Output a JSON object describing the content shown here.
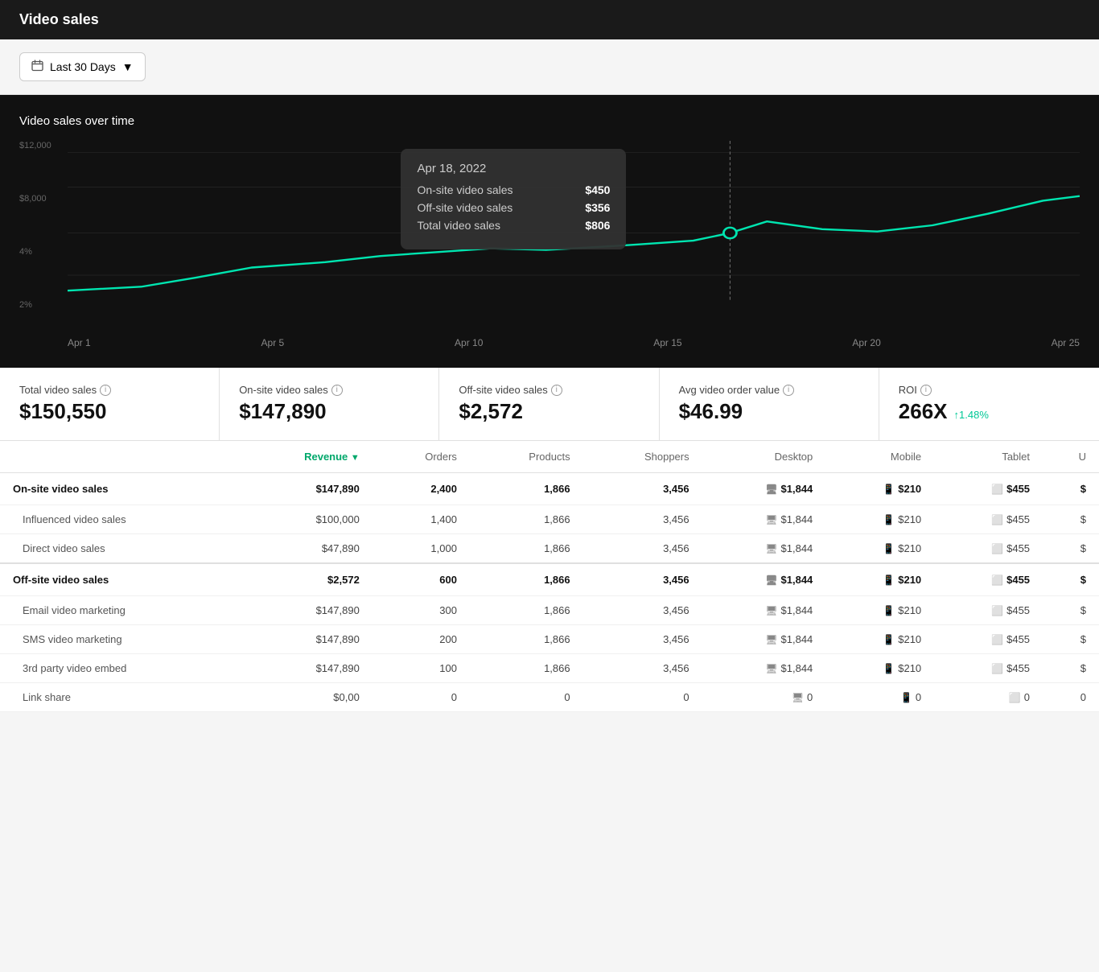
{
  "header": {
    "title": "Video sales"
  },
  "toolbar": {
    "date_filter_label": "Last 30 Days",
    "calendar_icon": "📅"
  },
  "chart": {
    "title": "Video sales over time",
    "y_labels": [
      "$12,000",
      "$8,000",
      "4%",
      "2%"
    ],
    "x_labels": [
      "Apr 1",
      "Apr 5",
      "Apr 10",
      "Apr 15",
      "Apr 20",
      "Apr 25"
    ],
    "tooltip": {
      "date": "Apr 18, 2022",
      "rows": [
        {
          "label": "On-site video sales",
          "value": "$450"
        },
        {
          "label": "Off-site video sales",
          "value": "$356"
        },
        {
          "label": "Total video sales",
          "value": "$806"
        }
      ]
    }
  },
  "metrics": [
    {
      "label": "Total video sales",
      "value": "$150,550",
      "change": null
    },
    {
      "label": "On-site video sales",
      "value": "$147,890",
      "change": null
    },
    {
      "label": "Off-site video sales",
      "value": "$2,572",
      "change": null
    },
    {
      "label": "Avg video order value",
      "value": "$46.99",
      "change": null
    },
    {
      "label": "ROI",
      "value": "266X",
      "change": "↑1.48%"
    }
  ],
  "table": {
    "columns": [
      "",
      "Revenue",
      "Orders",
      "Products",
      "Shoppers",
      "Desktop",
      "Mobile",
      "Tablet",
      "U"
    ],
    "sections": [
      {
        "header": {
          "name": "On-site video sales",
          "revenue": "$147,890",
          "orders": "2,400",
          "products": "1,866",
          "shoppers": "3,456",
          "desktop": "$1,844",
          "mobile": "$210",
          "tablet": "$455",
          "u": "$"
        },
        "rows": [
          {
            "name": "Influenced video sales",
            "revenue": "$100,000",
            "orders": "1,400",
            "products": "1,866",
            "shoppers": "3,456",
            "desktop": "$1,844",
            "mobile": "$210",
            "tablet": "$455",
            "u": "$"
          },
          {
            "name": "Direct video sales",
            "revenue": "$47,890",
            "orders": "1,000",
            "products": "1,866",
            "shoppers": "3,456",
            "desktop": "$1,844",
            "mobile": "$210",
            "tablet": "$455",
            "u": "$"
          }
        ]
      },
      {
        "header": {
          "name": "Off-site video sales",
          "revenue": "$2,572",
          "orders": "600",
          "products": "1,866",
          "shoppers": "3,456",
          "desktop": "$1,844",
          "mobile": "$210",
          "tablet": "$455",
          "u": "$"
        },
        "rows": [
          {
            "name": "Email video marketing",
            "revenue": "$147,890",
            "orders": "300",
            "products": "1,866",
            "shoppers": "3,456",
            "desktop": "$1,844",
            "mobile": "$210",
            "tablet": "$455",
            "u": "$"
          },
          {
            "name": "SMS video marketing",
            "revenue": "$147,890",
            "orders": "200",
            "products": "1,866",
            "shoppers": "3,456",
            "desktop": "$1,844",
            "mobile": "$210",
            "tablet": "$455",
            "u": "$"
          },
          {
            "name": "3rd party video embed",
            "revenue": "$147,890",
            "orders": "100",
            "products": "1,866",
            "shoppers": "3,456",
            "desktop": "$1,844",
            "mobile": "$210",
            "tablet": "$455",
            "u": "$"
          },
          {
            "name": "Link share",
            "revenue": "$0,00",
            "orders": "0",
            "products": "0",
            "shoppers": "0",
            "desktop": "0",
            "mobile": "0",
            "tablet": "0",
            "u": "0"
          }
        ]
      }
    ]
  }
}
